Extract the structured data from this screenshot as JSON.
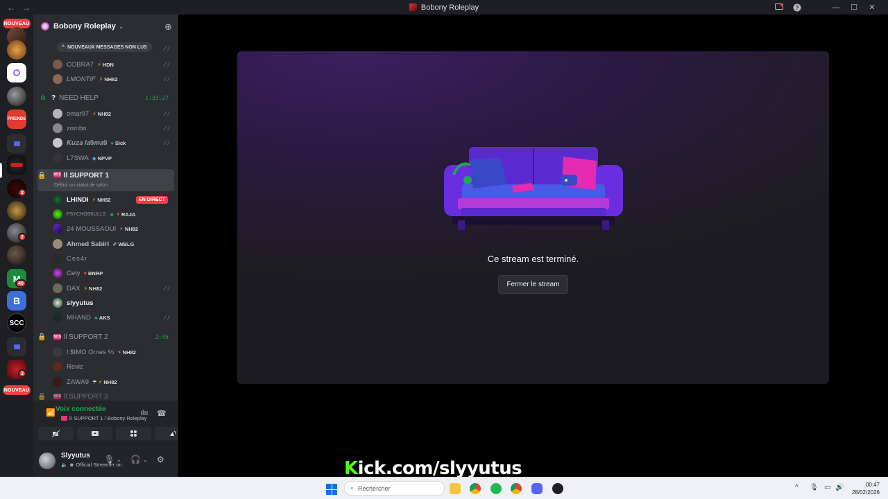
{
  "window": {
    "title": "Bobony Roleplay",
    "nav_back": "←",
    "nav_forward": "→",
    "minimize": "—",
    "maximize": "☐",
    "close": "✕"
  },
  "server_rail": {
    "nouveau_top": "NOUVEAU",
    "nouveau_bottom": "NOUVEAU",
    "badges": {
      "b1": "2",
      "b2": "2",
      "b3": "40",
      "b4": "3"
    },
    "scc_label": "SCC",
    "friends_label": "FRIENDS",
    "b_label": "B"
  },
  "server": {
    "name": "Bobony Roleplay",
    "chevron": "⌄",
    "add_member": "⊕"
  },
  "unread_banner": "NOUVEAUX MESSAGES NON LUS",
  "top_members": [
    {
      "name": "COBRA7",
      "tag": "HDN"
    },
    {
      "name": "LMONTIF",
      "tag": "NH82"
    }
  ],
  "need_help": {
    "name": "NEED HELP",
    "prefix": "?",
    "timer": "1:33:27",
    "members": [
      {
        "name": "omar97",
        "tag": "NH82"
      },
      {
        "name": "zombo",
        "tag": ""
      },
      {
        "name": "𝑲𝒖𝒛𝒂 𝒍𝒂𝟗𝒎𝒂𝟗",
        "tag": "Sick"
      },
      {
        "name": "L7SWA",
        "tag": "NPVP"
      }
    ]
  },
  "support1": {
    "name": "SUPPORT 1",
    "status_prompt": "Définir un statut de salon",
    "live_label": "EN DIRECT",
    "members": [
      {
        "name": "LHINDI",
        "tag": "NH82"
      },
      {
        "name": "PSYCHOSKULLS",
        "tag": "RAJA"
      },
      {
        "name": "24 MOUSSAOUI",
        "tag": "NH82"
      },
      {
        "name": "Ahmed Sabiri",
        "tag": "WBLG"
      },
      {
        "name": "Ces4r",
        "tag": ""
      },
      {
        "name": "Cety",
        "tag": "BNRP"
      },
      {
        "name": "DAX",
        "tag": "NH82"
      },
      {
        "name": "slyyutus",
        "tag": ""
      },
      {
        "name": "MHAND",
        "tag": "AKS"
      }
    ]
  },
  "support2": {
    "name": "SUPPORT 2",
    "timer": "2:45",
    "members": [
      {
        "name": "! $IMO Ornes %",
        "tag": "NH82"
      },
      {
        "name": "Reviz",
        "tag": ""
      },
      {
        "name": "ZAWA9",
        "tag": "NH82"
      }
    ]
  },
  "support3": {
    "name": "SUPPORT 3"
  },
  "voice_panel": {
    "status": "Voix connectée",
    "channel": "SUPPORT 1 / Bobony Roleplay"
  },
  "user_panel": {
    "name": "Slyyutus",
    "status": "Official Streamer on"
  },
  "stream": {
    "ended_message": "Ce stream est terminé.",
    "close_button": "Fermer le stream"
  },
  "overlay": {
    "kick_k": "K",
    "kick_rest": "ick.com/slyyutus"
  },
  "taskbar": {
    "search_placeholder": "Rechercher",
    "time": "00:47",
    "date": "28/02/2026",
    "tray_chevron": "^"
  },
  "colors": {
    "accent_green": "#23a55a",
    "live_red": "#f23f43",
    "kick_green": "#53fc18",
    "card_purple": "#3b1f60"
  }
}
